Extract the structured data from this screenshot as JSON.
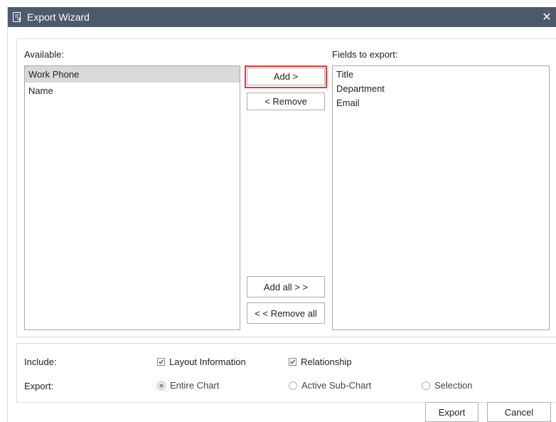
{
  "window": {
    "title": "Export Wizard",
    "title_icon": "export-document-icon",
    "close_glyph": "✕",
    "titlebar_color": "#4d5a6b"
  },
  "available": {
    "label": "Available:",
    "items": [
      {
        "label": "Work Phone",
        "selected": true
      },
      {
        "label": "Name",
        "selected": false
      }
    ]
  },
  "fields_to_export": {
    "label": "Fields to export:",
    "items": [
      {
        "label": "Title"
      },
      {
        "label": "Department"
      },
      {
        "label": "Email"
      }
    ]
  },
  "transfer_buttons": {
    "add": "Add >",
    "remove": "< Remove",
    "add_all": "Add all > >",
    "remove_all": "< < Remove all"
  },
  "highlight_color": "#e53935",
  "include": {
    "label": "Include:",
    "options": [
      {
        "label": "Layout Information",
        "checked": true
      },
      {
        "label": "Relationship",
        "checked": true
      }
    ]
  },
  "export_scope": {
    "label": "Export:",
    "options": [
      {
        "label": "Entire Chart",
        "selected": true
      },
      {
        "label": "Active Sub-Chart",
        "selected": false
      },
      {
        "label": "Selection",
        "selected": false
      }
    ]
  },
  "footer": {
    "export": "Export",
    "cancel": "Cancel"
  }
}
